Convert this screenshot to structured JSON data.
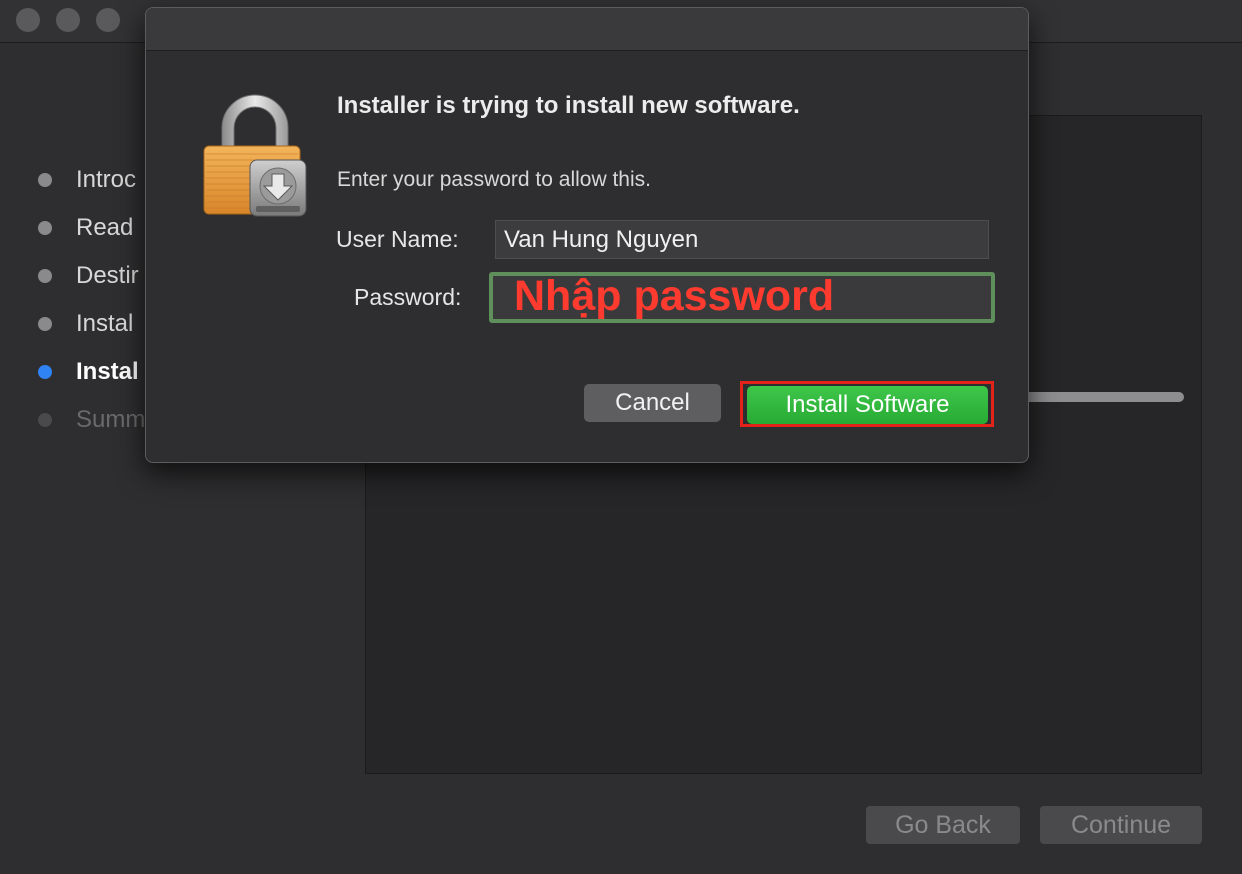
{
  "installer": {
    "steps": [
      {
        "label": "Introc",
        "state": "done"
      },
      {
        "label": "Read",
        "state": "done"
      },
      {
        "label": "Destir",
        "state": "done"
      },
      {
        "label": "Instal",
        "state": "done"
      },
      {
        "label": "Instal",
        "state": "active"
      },
      {
        "label": "Summ",
        "state": "pending"
      }
    ],
    "go_back_label": "Go Back",
    "continue_label": "Continue"
  },
  "dialog": {
    "title": "Installer is trying to install new software.",
    "subtitle": "Enter your password to allow this.",
    "username_label": "User Name:",
    "username_value": "Van Hung Nguyen",
    "password_label": "Password:",
    "password_annotation": "Nhập password",
    "cancel_label": "Cancel",
    "install_label": "Install Software",
    "icon": "lock-icon"
  },
  "colors": {
    "accent_blue": "#2f83f5",
    "install_green": "#34b83f",
    "annotation_red": "#ff3b2f",
    "highlight_green": "#5f8f5a",
    "highlight_red": "#e2231a"
  }
}
